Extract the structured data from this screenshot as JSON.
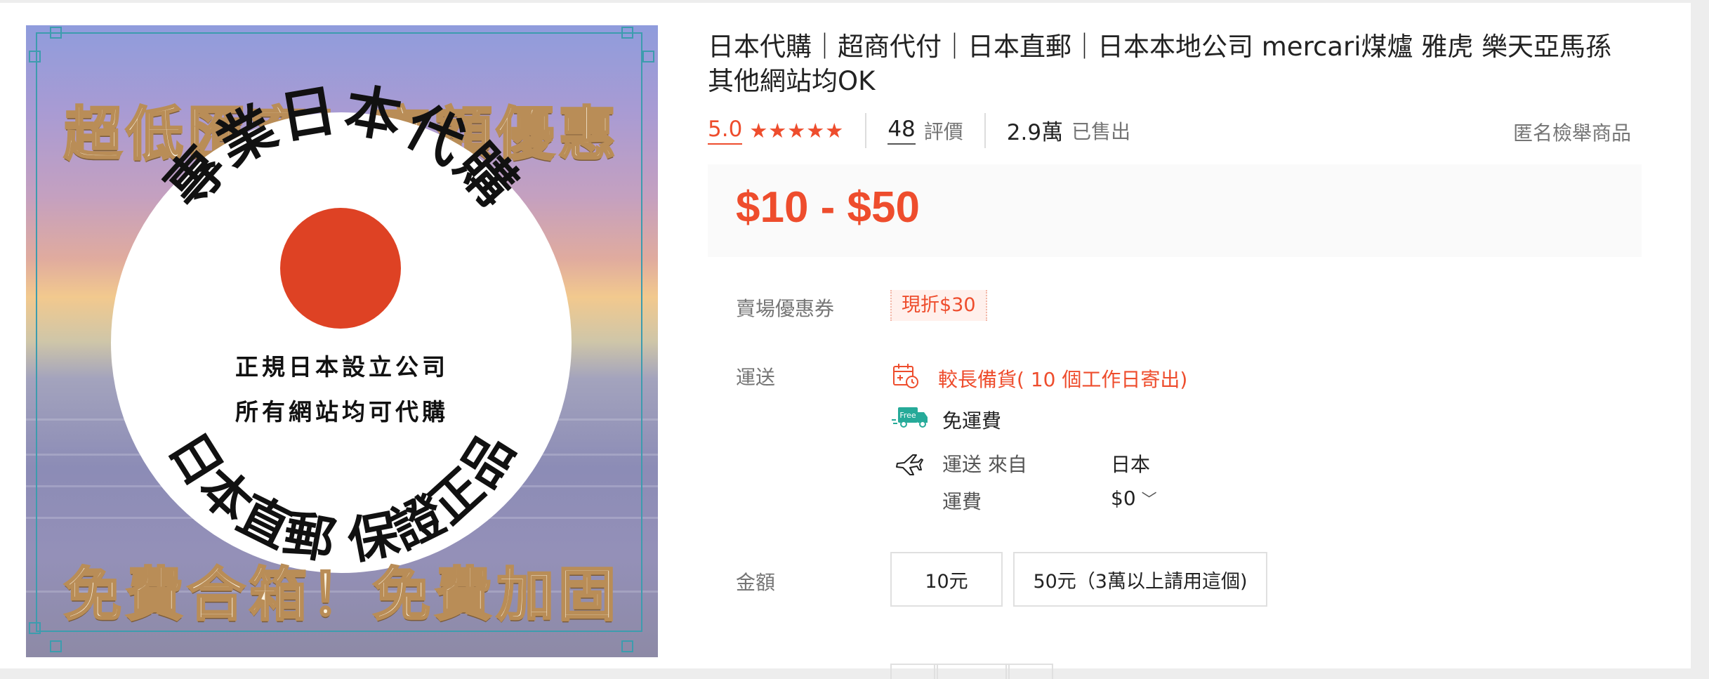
{
  "product": {
    "title": "日本代購｜超商代付｜日本直郵｜日本本地公司 mercari煤爐 雅虎 樂天亞馬孫 其他網站均OK",
    "image": {
      "banner_top": "超低匯率！高額優惠",
      "arc_top": "專業日本代購",
      "line1": "正規日本設立公司",
      "line2": "所有網站均可代購",
      "arc_bottom": "日本直郵 保證正品",
      "banner_bottom": "免費合箱！免費加固"
    }
  },
  "stats": {
    "rating": "5.0",
    "stars": "★★★★★",
    "reviews_count": "48",
    "reviews_label": "評價",
    "sold_count": "2.9萬",
    "sold_label": "已售出",
    "report": "匿名檢舉商品"
  },
  "price": "$10 - $50",
  "coupon": {
    "label": "賣場優惠券",
    "value": "現折$30"
  },
  "shipping": {
    "label": "運送",
    "long_prep": "較長備貨( 10 個工作日寄出)",
    "free_badge": "Free",
    "free_text": "免運費",
    "from_label": "運送 來自",
    "from_value": "日本",
    "fee_label": "運費",
    "fee_value": "$0",
    "fee_chevron": "﹀"
  },
  "variation": {
    "label": "金額",
    "options": [
      "10元",
      "50元（3萬以上請用這個)"
    ]
  },
  "colors": {
    "accent": "#ee4d2d",
    "free_green": "#26aa99",
    "sun_red": "#de4224"
  },
  "icons": [
    "calendar-clock-icon",
    "free-shipping-truck-icon",
    "airplane-icon",
    "chevron-down-icon",
    "star-icon"
  ]
}
